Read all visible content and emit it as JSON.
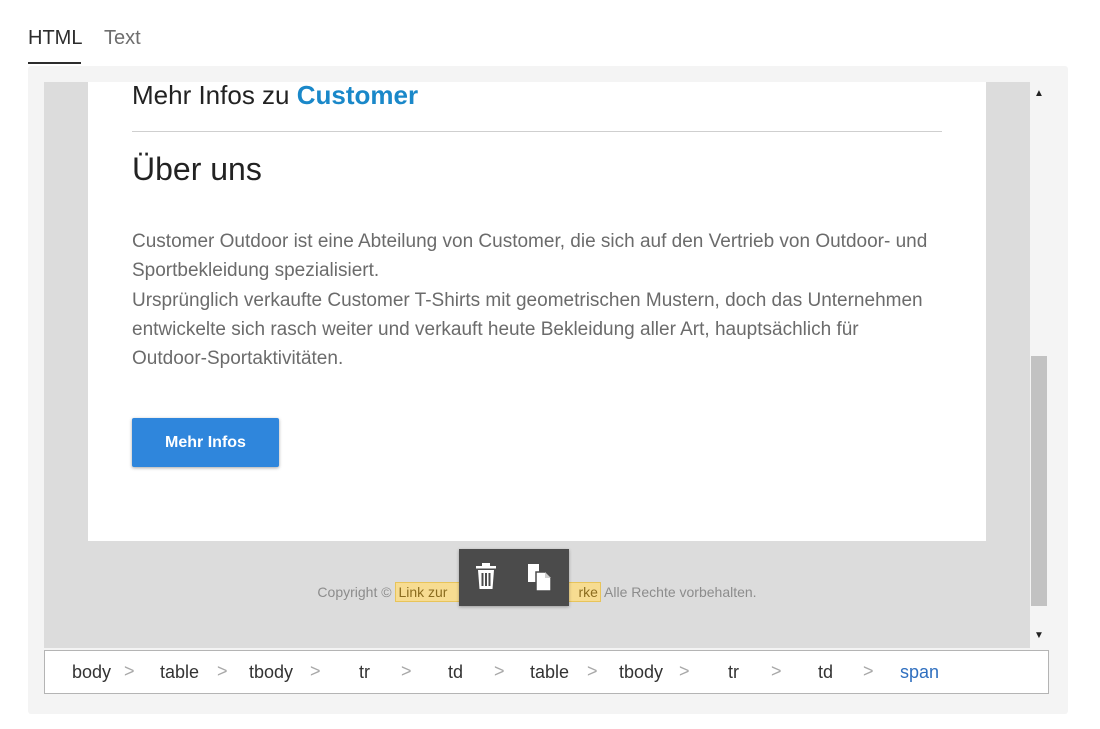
{
  "tabs": [
    {
      "label": "HTML",
      "active": true
    },
    {
      "label": "Text",
      "active": false
    }
  ],
  "email": {
    "more_info_prefix": "Mehr Infos zu ",
    "more_info_brand": "Customer",
    "about_heading": "Über uns",
    "paragraph_1": "Customer Outdoor ist eine Abteilung von Customer, die sich auf den Vertrieb von Outdoor- und Sportbekleidung spezialisiert.",
    "paragraph_2": "Ursprünglich verkaufte Customer T-Shirts mit geometrischen Mustern, doch das Unternehmen entwickelte sich rasch weiter und verkauft heute Bekleidung aller Art, hauptsächlich für Outdoor-Sportaktivitäten.",
    "cta_label": "Mehr Infos",
    "brand_color": "#1a88c9",
    "cta_color": "#2f86dc"
  },
  "footer": {
    "copyright": "Copyright © ",
    "link_start": "Link zur",
    "link_end": "rke",
    "rights": " Alle Rechte vorbehalten."
  },
  "toolbar": {
    "icons": [
      "trash-icon",
      "copy-icon"
    ]
  },
  "scrollbar": {
    "up_glyph": "▲",
    "down_glyph": "▼"
  },
  "breadcrumb": {
    "items": [
      "body",
      "table",
      "tbody",
      "tr",
      "td",
      "table",
      "tbody",
      "tr",
      "td",
      "span"
    ],
    "separator": ">"
  }
}
